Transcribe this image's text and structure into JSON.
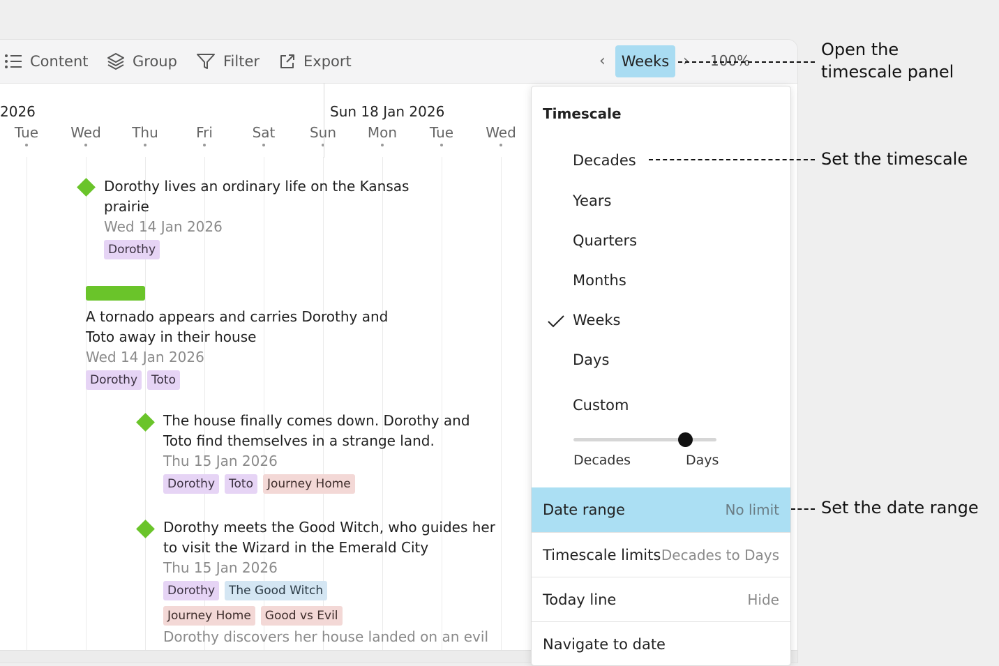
{
  "toolbar": {
    "content_label": "Content",
    "group_label": "Group",
    "filter_label": "Filter",
    "export_label": "Export",
    "timescale_button_label": "Weeks",
    "zoom_label": "100%",
    "prev_arrow": "‹",
    "next_arrow": "›"
  },
  "timeline": {
    "week_labels": [
      "2026",
      "Sun 18 Jan 2026"
    ],
    "days": [
      "Tue",
      "Wed",
      "Thu",
      "Fri",
      "Sat",
      "Sun",
      "Mon",
      "Tue",
      "Wed"
    ],
    "events": [
      {
        "title_line1": "Dorothy lives an ordinary life on the Kansas",
        "title_line2": "prairie",
        "date": "Wed 14 Jan 2026",
        "tags": [
          "Dorothy"
        ]
      },
      {
        "title_line1": "A tornado appears and carries Dorothy and",
        "title_line2": "Toto away in their house",
        "date": "Wed 14 Jan 2026",
        "tags": [
          "Dorothy",
          "Toto"
        ]
      },
      {
        "title_line1": "The house finally comes down. Dorothy and",
        "title_line2": "Toto find themselves in a strange land.",
        "date": "Thu 15 Jan 2026",
        "tags": [
          "Dorothy",
          "Toto",
          "Journey Home"
        ]
      },
      {
        "title_line1": "Dorothy meets the Good Witch, who guides her",
        "title_line2": "to visit the Wizard in the Emerald City",
        "date": "Thu 15 Jan 2026",
        "tags": [
          "Dorothy",
          "The Good Witch",
          "Journey Home",
          "Good vs Evil"
        ]
      },
      {
        "title_line1": "Dorothy discovers her house landed on an evil"
      }
    ]
  },
  "panel": {
    "title": "Timescale",
    "options": [
      "Decades",
      "Years",
      "Quarters",
      "Months",
      "Weeks",
      "Days",
      "Custom"
    ],
    "selected": "Weeks",
    "slider": {
      "min_label": "Decades",
      "max_label": "Days",
      "value_fraction": 0.78
    },
    "rows": [
      {
        "key": "Date range",
        "value": "No limit"
      },
      {
        "key": "Timescale limits",
        "value": "Decades to Days"
      },
      {
        "key": "Today line",
        "value": "Hide"
      },
      {
        "key": "Navigate to date",
        "value": ""
      }
    ]
  },
  "callouts": {
    "open_panel_line1": "Open the",
    "open_panel_line2": "timescale panel",
    "set_timescale": "Set the timescale",
    "set_date_range": "Set the date range"
  },
  "colors": {
    "accent_blue": "#a9dcf2",
    "milestone_green": "#6ac42a"
  }
}
